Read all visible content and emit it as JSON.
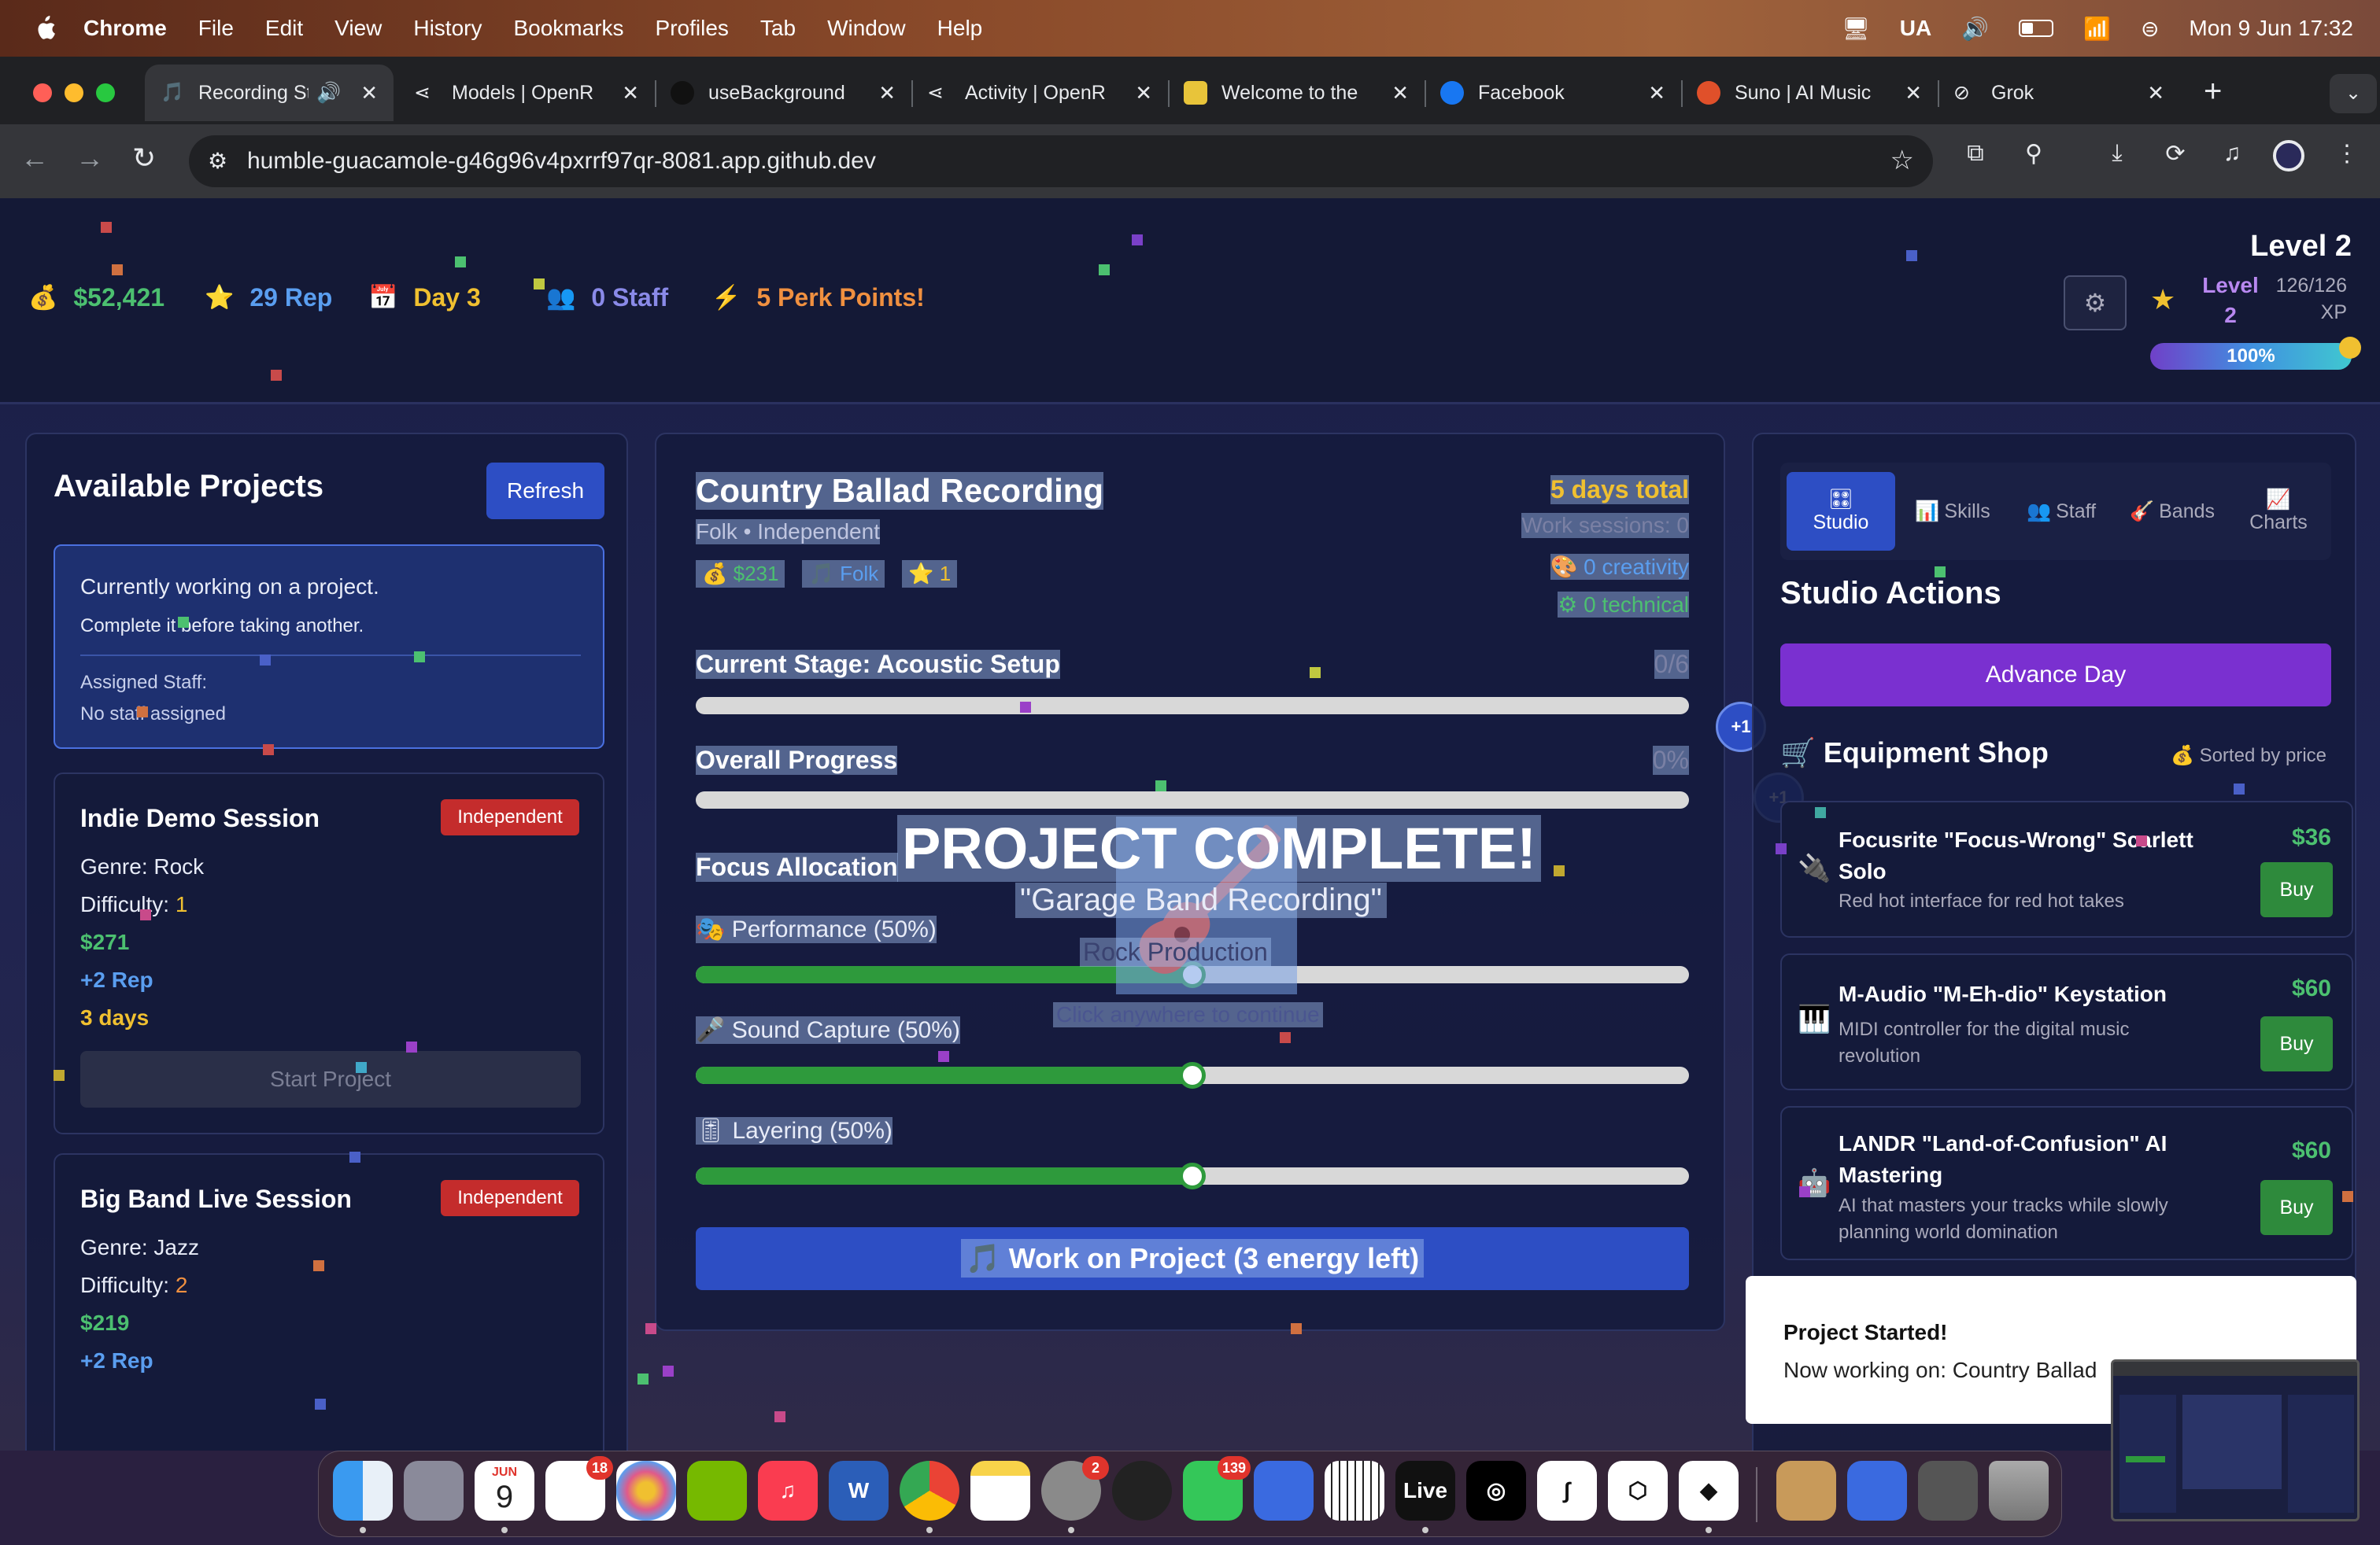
{
  "menubar": {
    "app": "Chrome",
    "items": [
      "File",
      "Edit",
      "View",
      "History",
      "Bookmarks",
      "Profiles",
      "Tab",
      "Window",
      "Help"
    ],
    "input_source": "UA",
    "datetime": "Mon 9 Jun  17:32"
  },
  "browser": {
    "tabs": [
      {
        "title": "Recording St",
        "active": true
      },
      {
        "title": "Models | OpenR"
      },
      {
        "title": "useBackground"
      },
      {
        "title": "Activity | OpenR"
      },
      {
        "title": "Welcome to the"
      },
      {
        "title": "Facebook"
      },
      {
        "title": "Suno | AI Music"
      },
      {
        "title": "Grok"
      }
    ],
    "url": "humble-guacamole-g46g96v4pxrrf97qr-8081.app.github.dev"
  },
  "game": {
    "stats": {
      "money": "$52,421",
      "rep": "29 Rep",
      "day": "Day 3",
      "staff": "0 Staff",
      "perks": "5 Perk Points!"
    },
    "level": {
      "title": "Level 2",
      "short": "Level 2",
      "xp": "126/126 XP",
      "percent_label": "100%",
      "percent": 100
    },
    "left": {
      "heading": "Available Projects",
      "refresh": "Refresh",
      "notice": {
        "line1": "Currently working on a project.",
        "line2": "Complete it before taking another.",
        "staff_label": "Assigned Staff:",
        "staff_value": "No staff assigned"
      },
      "projects": [
        {
          "name": "Indie Demo Session",
          "badge": "Independent",
          "genre": "Genre: Rock",
          "difficulty_label": "Difficulty:",
          "difficulty": "1",
          "pay": "$271",
          "rep": "+2 Rep",
          "days": "3 days",
          "action": "Start Project"
        },
        {
          "name": "Big Band Live Session",
          "badge": "Independent",
          "genre": "Genre: Jazz",
          "difficulty_label": "Difficulty:",
          "difficulty": "2",
          "pay": "$219",
          "rep": "+2 Rep"
        }
      ]
    },
    "center": {
      "title": "Country Ballad Recording",
      "subtitle": "Folk • Independent",
      "tags": [
        "$231",
        "Folk",
        "1"
      ],
      "days_total": "5 days total",
      "work_sessions": "Work sessions: 0",
      "creativity": "0 creativity",
      "technical": "0 technical",
      "stage": "Current Stage: Acoustic Setup",
      "stage_count": "0/6",
      "stage_progress": 0,
      "overall": "Overall Progress",
      "overall_pct": "0%",
      "overall_progress": 0,
      "focus_heading": "Focus Allocation",
      "sliders": [
        {
          "label": "Performance (50%)",
          "value": 50
        },
        {
          "label": "Sound Capture (50%)",
          "value": 50
        },
        {
          "label": "Layering (50%)",
          "value": 50
        }
      ],
      "work_button": "Work on Project (3 energy left)",
      "overlay": {
        "title": "PROJECT COMPLETE!",
        "name": "\"Garage Band Recording\"",
        "type": "Rock Production",
        "hint": "Click anywhere to continue"
      },
      "plus_one": "+1"
    },
    "right": {
      "tabs": [
        "Studio",
        "Skills",
        "Staff",
        "Bands",
        "Charts"
      ],
      "heading": "Studio Actions",
      "advance": "Advance Day",
      "shop_heading": "Equipment Shop",
      "sorted": "Sorted by price",
      "items": [
        {
          "name": "Focusrite \"Focus-Wrong\" Scarlett Solo",
          "desc": "Red hot interface for red hot takes",
          "price": "$36",
          "buy": "Buy"
        },
        {
          "name": "M-Audio \"M-Eh-dio\" Keystation",
          "desc": "MIDI controller for the digital music revolution",
          "price": "$60",
          "buy": "Buy"
        },
        {
          "name": "LANDR \"Land-of-Confusion\" AI Mastering",
          "desc": "AI that masters your tracks while slowly planning world domination",
          "price": "$60",
          "buy": "Buy"
        }
      ]
    },
    "toast": {
      "title": "Project Started!",
      "body": "Now working on: Country Ballad"
    }
  },
  "dock": {
    "calendar_month": "JUN",
    "calendar_day": "9",
    "reminders_badge": "18",
    "settings_badge": "2",
    "messages_badge": "139",
    "live_label": "Live"
  }
}
